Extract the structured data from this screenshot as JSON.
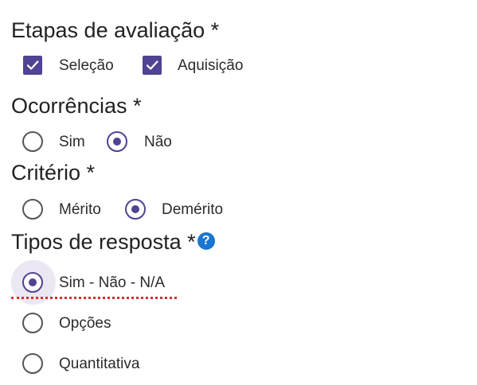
{
  "colors": {
    "accent": "#4f4393",
    "help": "#1976d2",
    "error": "#d32f2f"
  },
  "sections": {
    "etapas": {
      "title": "Etapas de avaliação *",
      "options": [
        {
          "label": "Seleção",
          "checked": true
        },
        {
          "label": "Aquisição",
          "checked": true
        }
      ]
    },
    "ocorrencias": {
      "title": "Ocorrências *",
      "options": [
        {
          "label": "Sim",
          "selected": false
        },
        {
          "label": "Não",
          "selected": true
        }
      ]
    },
    "criterio": {
      "title": "Critério *",
      "options": [
        {
          "label": "Mérito",
          "selected": false
        },
        {
          "label": "Demérito",
          "selected": true
        }
      ]
    },
    "tipos": {
      "title": "Tipos de resposta *",
      "help_icon": "question-circle-icon",
      "help_glyph": "?",
      "options": [
        {
          "label": "Sim - Não - N/A",
          "selected": true
        },
        {
          "label": "Opções",
          "selected": false
        },
        {
          "label": "Quantitativa",
          "selected": false
        }
      ]
    }
  }
}
